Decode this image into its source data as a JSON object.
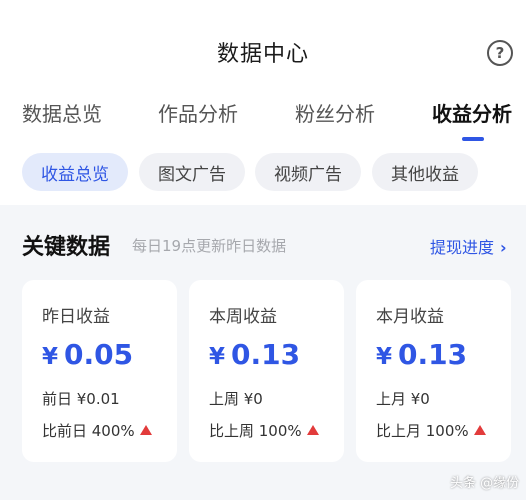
{
  "header": {
    "title": "数据中心",
    "help_icon": "?"
  },
  "tabs": [
    {
      "label": "数据总览",
      "active": false
    },
    {
      "label": "作品分析",
      "active": false
    },
    {
      "label": "粉丝分析",
      "active": false
    },
    {
      "label": "收益分析",
      "active": true
    }
  ],
  "subtabs": [
    {
      "label": "收益总览",
      "active": true
    },
    {
      "label": "图文广告",
      "active": false
    },
    {
      "label": "视频广告",
      "active": false
    },
    {
      "label": "其他收益",
      "active": false
    }
  ],
  "section": {
    "title": "关键数据",
    "subtitle": "每日19点更新昨日数据",
    "link": "提现进度",
    "link_chevron": "›"
  },
  "cards": [
    {
      "label": "昨日收益",
      "currency": "¥",
      "value": "0.05",
      "prev": "前日 ¥0.01",
      "compare": "比前日 400%"
    },
    {
      "label": "本周收益",
      "currency": "¥",
      "value": "0.13",
      "prev": "上周 ¥0",
      "compare": "比上周 100%"
    },
    {
      "label": "本月收益",
      "currency": "¥",
      "value": "0.13",
      "prev": "上月 ¥0",
      "compare": "比上月 100%"
    }
  ],
  "watermark": "头条 @缘份",
  "colors": {
    "accent": "#2f56e4",
    "increase": "#e23b3b",
    "background": "#f4f6f9"
  }
}
